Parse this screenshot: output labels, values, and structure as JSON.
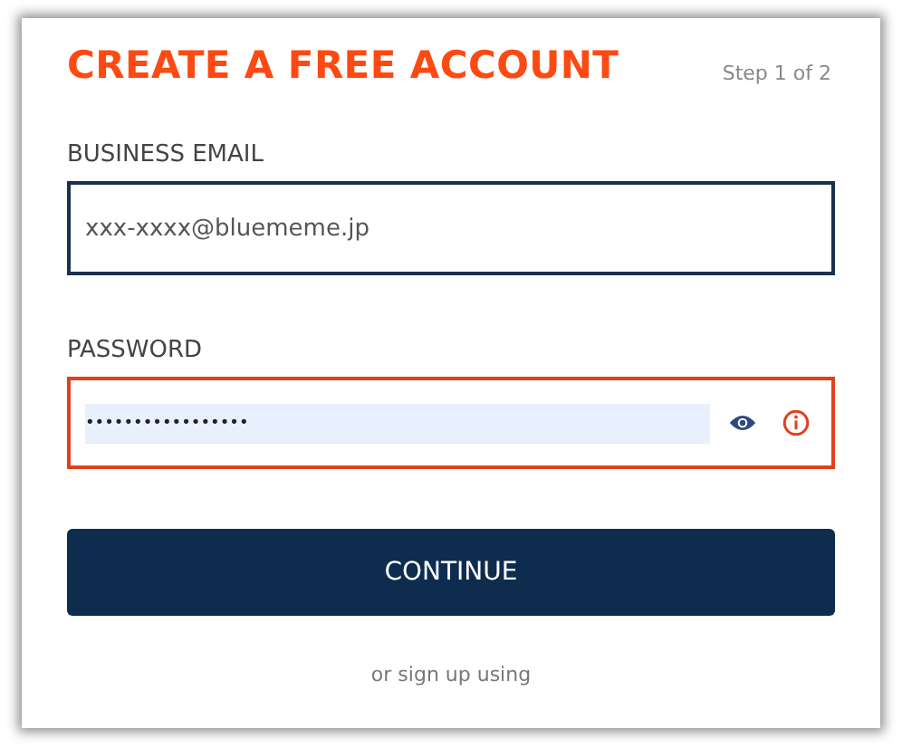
{
  "title": "CREATE A FREE ACCOUNT",
  "step": "Step 1 of 2",
  "fields": [
    {
      "kind": "email",
      "label": "BUSINESS EMAIL",
      "value": "xxx-xxxx@bluememe.jp",
      "error": false
    },
    {
      "kind": "password",
      "label": "PASSWORD",
      "value": "•••••••••••••••••",
      "error": true
    }
  ],
  "button": "CONTINUE",
  "alt_signup": "or sign up using"
}
